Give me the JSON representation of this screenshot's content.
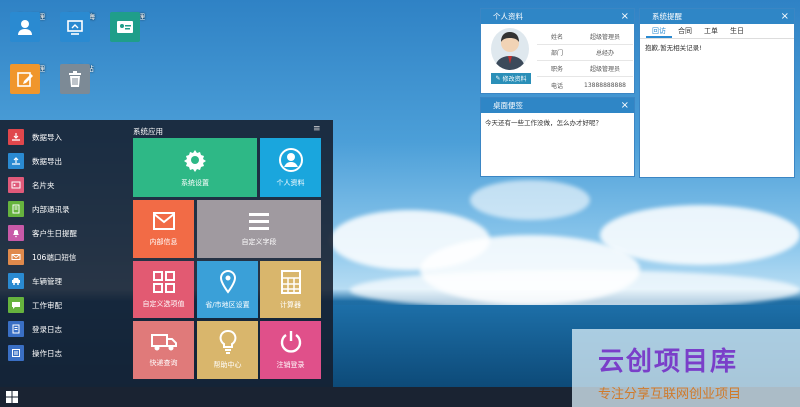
{
  "desktop": {
    "icons": [
      {
        "label": "客户管理",
        "icon": "users-icon",
        "color": "#2a8ad1"
      },
      {
        "label": "客户公海",
        "icon": "ocean-icon",
        "color": "#2a8ad1"
      },
      {
        "label": "员工管理",
        "icon": "id-card-icon",
        "color": "#1f9e8a"
      },
      {
        "label": "盾单管理",
        "icon": "edit-icon",
        "color": "#f0962c"
      },
      {
        "label": "回 收 站",
        "icon": "trash-icon",
        "color": "#7c8a96"
      }
    ]
  },
  "profile_window": {
    "title": "个人资料",
    "close": "×",
    "rows": [
      {
        "label": "姓名",
        "value": "超级管理员"
      },
      {
        "label": "部门",
        "value": "总经办"
      },
      {
        "label": "职务",
        "value": "超级管理员"
      },
      {
        "label": "电话",
        "value": "13888888888"
      }
    ],
    "edit_button": "修改资料"
  },
  "reminder_window": {
    "title": "系统提醒",
    "close": "×",
    "tabs": [
      "回访",
      "合同",
      "工单",
      "生日"
    ],
    "active_tab": 0,
    "message": "抱歉,暂无相关记录!"
  },
  "memo_window": {
    "title": "桌面便签",
    "close": "×",
    "text": "今天还有一些工作没做，怎么办才好呢？"
  },
  "start_menu": {
    "items": [
      {
        "label": "数据导入",
        "icon": "import-icon",
        "color": "#e0474c"
      },
      {
        "label": "数据导出",
        "icon": "export-icon",
        "color": "#2a8ad1"
      },
      {
        "label": "名片夹",
        "icon": "card-icon",
        "color": "#e05a7a"
      },
      {
        "label": "内部通讯录",
        "icon": "book-icon",
        "color": "#66b33e"
      },
      {
        "label": "客户生日提醒",
        "icon": "bell-icon",
        "color": "#c85aa8"
      },
      {
        "label": "106端口短信",
        "icon": "mail-icon",
        "color": "#e08a4c"
      },
      {
        "label": "车辆管理",
        "icon": "car-icon",
        "color": "#2a8ad1"
      },
      {
        "label": "工作审配",
        "icon": "chat-icon",
        "color": "#66b33e"
      },
      {
        "label": "登录日志",
        "icon": "log-icon",
        "color": "#3a6fc4"
      },
      {
        "label": "操作日志",
        "icon": "oplog-icon",
        "color": "#3a6fc4"
      }
    ],
    "apps_header": "系统应用",
    "menu_glyph": "≡",
    "tiles": [
      {
        "label": "系统设置",
        "icon": "gear-icon",
        "color": "#2eb886"
      },
      {
        "label": "个人资料",
        "icon": "person-icon",
        "color": "#1aa6dd"
      },
      {
        "label": "内部信息",
        "icon": "envelope-icon",
        "color": "#f26b46"
      },
      {
        "label": "自定义字段",
        "icon": "list-icon",
        "color": "#a09aa0"
      },
      {
        "label": "自定义选项值",
        "icon": "grid-icon",
        "color": "#e25a72"
      },
      {
        "label": "省/市地区设置",
        "icon": "pin-icon",
        "color": "#3aa0d8"
      },
      {
        "label": "计算器",
        "icon": "calculator-icon",
        "color": "#d9b66c"
      },
      {
        "label": "快递查询",
        "icon": "truck-icon",
        "color": "#e07a7a"
      },
      {
        "label": "帮助中心",
        "icon": "bulb-icon",
        "color": "#d9b66c"
      },
      {
        "label": "注销登录",
        "icon": "power-icon",
        "color": "#e0508a"
      }
    ]
  },
  "taskbar": {
    "start_icon": "windows-icon"
  },
  "watermark": {
    "title": "云创项目库",
    "subtitle": "专注分享互联网创业项目"
  }
}
